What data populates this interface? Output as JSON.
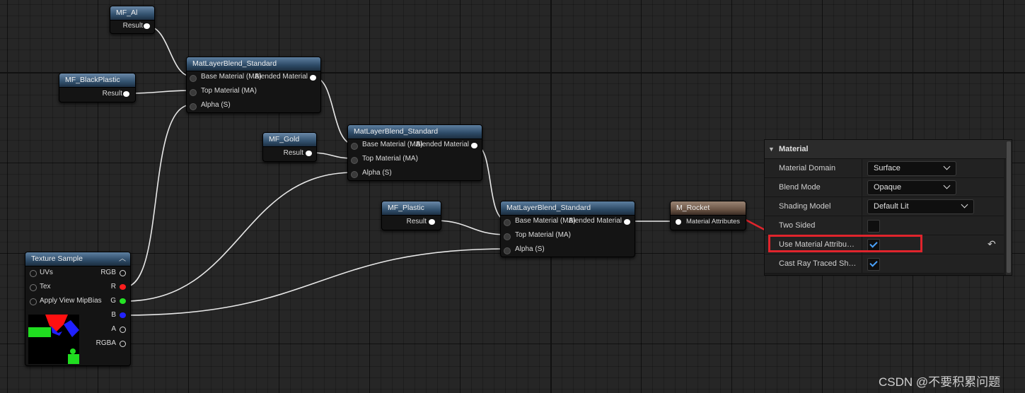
{
  "nodes": {
    "mf_al": {
      "title": "MF_Al",
      "output": "Result"
    },
    "mf_blackplastic": {
      "title": "MF_BlackPlastic",
      "output": "Result"
    },
    "mf_gold": {
      "title": "MF_Gold",
      "output": "Result"
    },
    "mf_plastic": {
      "title": "MF_Plastic",
      "output": "Result"
    },
    "blend_standard": {
      "title": "MatLayerBlend_Standard",
      "input_base": "Base Material (MA)",
      "input_top": "Top Material (MA)",
      "input_alpha": "Alpha (S)",
      "output": "Blended Material"
    },
    "m_rocket": {
      "title": "M_Rocket",
      "input": "Material Attributes"
    },
    "texture_sample": {
      "title": "Texture Sample",
      "inputs": [
        "UVs",
        "Tex",
        "Apply View MipBias"
      ],
      "outputs": [
        "RGB",
        "R",
        "G",
        "B",
        "A",
        "RGBA"
      ]
    }
  },
  "panel": {
    "title": "Material",
    "rows": [
      {
        "label": "Material Domain",
        "value": "Surface"
      },
      {
        "label": "Blend Mode",
        "value": "Opaque"
      },
      {
        "label": "Shading Model",
        "value": "Default Lit"
      },
      {
        "label": "Two Sided",
        "checked": false
      },
      {
        "label": "Use Material Attribu…",
        "checked": true
      },
      {
        "label": "Cast Ray Traced Sh…",
        "checked": true
      }
    ]
  },
  "pin_colors": {
    "r": "#ff1e1e",
    "g": "#25e325",
    "b": "#2323ff"
  },
  "highlight_color": "#e0242c",
  "watermark": "CSDN @不要积累问题"
}
